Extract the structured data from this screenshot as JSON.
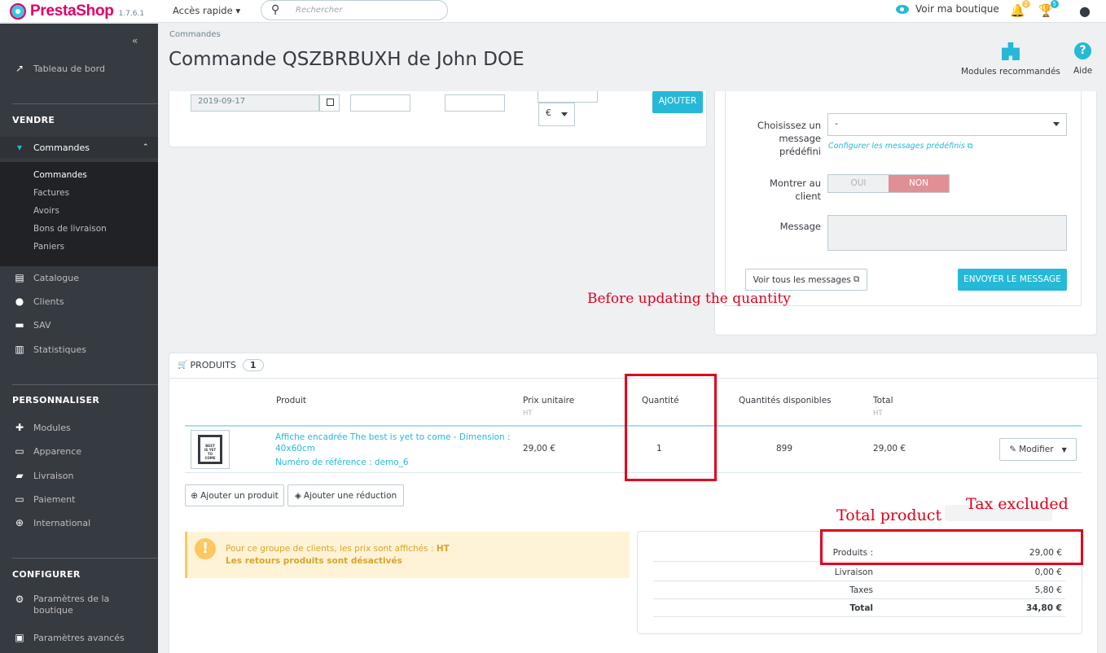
{
  "topbar": {
    "brand": "PrestaShop",
    "version": "1.7.6.1",
    "quick_access": "Accès rapide ▾",
    "search_placeholder": "Rechercher",
    "view_shop": "Voir ma boutique",
    "notif_badges": [
      "2",
      "5"
    ],
    "accent": "#25b9d7",
    "brand_color": "#df0067"
  },
  "sidebar": {
    "collapse": "«",
    "dashboard": "Tableau de bord",
    "sections": {
      "sell": "VENDRE",
      "customize": "PERSONNALISER",
      "configure": "CONFIGURER"
    },
    "orders": "Commandes",
    "orders_sub": [
      "Commandes",
      "Factures",
      "Avoirs",
      "Bons de livraison",
      "Paniers"
    ],
    "sell_items": [
      "Catalogue",
      "Clients",
      "SAV",
      "Statistiques"
    ],
    "customize_items": [
      "Modules",
      "Apparence",
      "Livraison",
      "Paiement",
      "International"
    ],
    "configure_items": [
      "Paramètres de la boutique",
      "Paramètres avancés"
    ]
  },
  "header": {
    "breadcrumb": "Commandes",
    "title": "Commande QSZBRBUXH de John DOE",
    "recommended_modules": "Modules recommandés",
    "help": "Aide"
  },
  "payment_row": {
    "date": "2019-09-17",
    "currency": "€",
    "add_button": "AJOUTER"
  },
  "messages": {
    "predefined_label": "Choisissez un message prédéfini",
    "predefined_value": "-",
    "configure_link": "Configurer les messages prédéfinis",
    "show_client_label": "Montrer au client",
    "yes": "OUI",
    "no": "NON",
    "message_label": "Message",
    "view_all": "Voir tous les messages",
    "send": "ENVOYER LE MESSAGE"
  },
  "annotations": {
    "before": "Before updating the quantity",
    "total_product": "Total product :",
    "tax_excluded": "Tax excluded"
  },
  "products": {
    "heading": "PRODUITS",
    "count": "1",
    "columns": {
      "product": "Produit",
      "unit_price": "Prix unitaire",
      "unit_price_sub": "HT",
      "quantity": "Quantité",
      "available": "Quantités disponibles",
      "total": "Total",
      "total_sub": "HT"
    },
    "rows": [
      {
        "name": "Affiche encadrée The best is yet to come - Dimension : 40x60cm",
        "reference": "Numéro de référence : demo_6",
        "unit_price": "29,00 €",
        "quantity": "1",
        "available": "899",
        "total": "29,00 €",
        "edit": "Modifier"
      }
    ],
    "add_product": "Ajouter un produit",
    "add_discount": "Ajouter une réduction"
  },
  "alert": {
    "line1_prefix": "Pour ce groupe de clients, les prix sont affichés : ",
    "line1_value": "HT",
    "line2": "Les retours produits sont désactivés"
  },
  "totals": [
    {
      "label": "Produits :",
      "value": "29,00 €"
    },
    {
      "label": "Livraison",
      "value": "0,00 €"
    },
    {
      "label": "Taxes",
      "value": "5,80 €"
    },
    {
      "label": "Total",
      "value": "34,80 €"
    }
  ]
}
